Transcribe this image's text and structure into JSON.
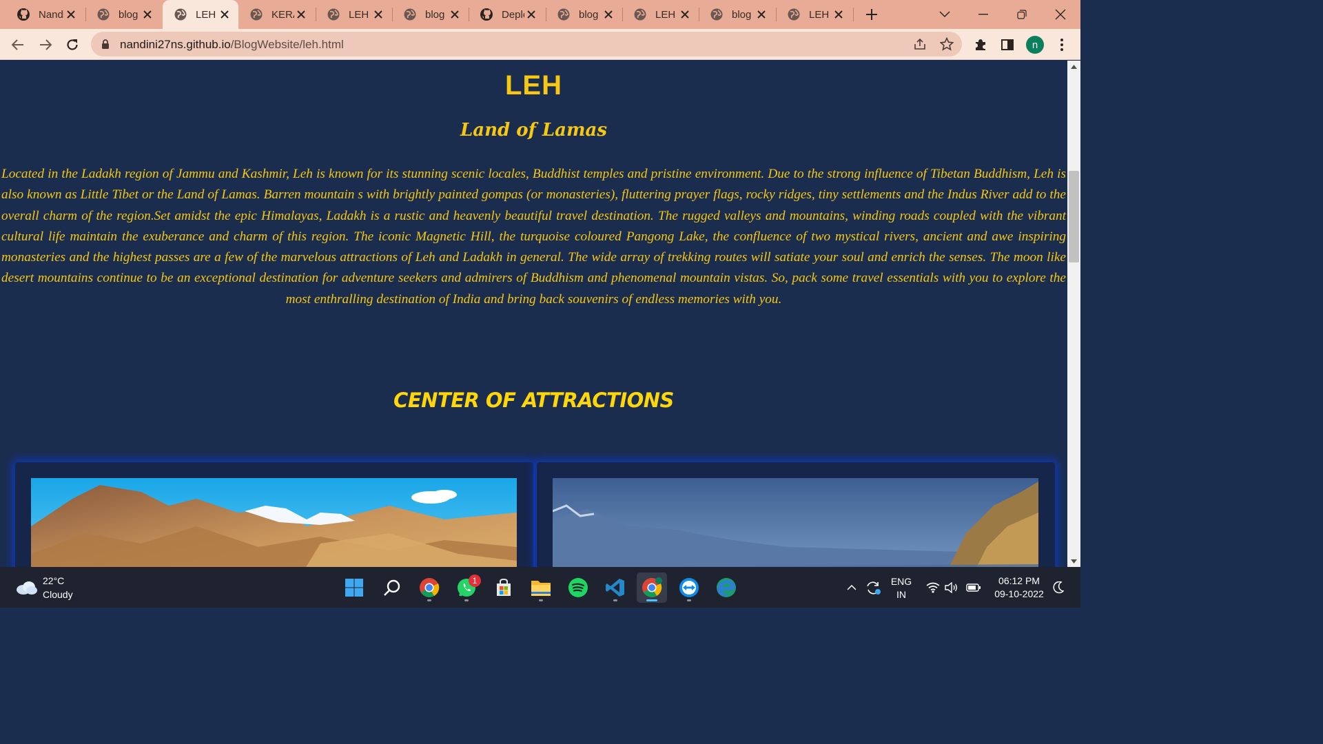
{
  "browser": {
    "tabs": [
      {
        "label": "Nandini",
        "favicon": "github-icon"
      },
      {
        "label": "blog",
        "favicon": "globe-icon"
      },
      {
        "label": "LEH",
        "favicon": "globe-icon",
        "active": true
      },
      {
        "label": "KERALA",
        "favicon": "globe-icon"
      },
      {
        "label": "LEH",
        "favicon": "globe-icon"
      },
      {
        "label": "blog",
        "favicon": "globe-icon"
      },
      {
        "label": "Deployments",
        "favicon": "github-icon"
      },
      {
        "label": "blog",
        "favicon": "globe-icon"
      },
      {
        "label": "LEH",
        "favicon": "globe-icon"
      },
      {
        "label": "blog",
        "favicon": "globe-icon"
      },
      {
        "label": "LEH",
        "favicon": "globe-icon"
      }
    ],
    "url_host": "nandini27ns.github.io",
    "url_path": "/BlogWebsite/leh.html",
    "profile_initial": "n"
  },
  "page": {
    "title": "LEH",
    "subtitle": "Land of Lamas",
    "intro": "Located in the Ladakh region of Jammu and Kashmir, Leh is known for its stunning scenic locales, Buddhist temples and pristine environment. Due to the strong influence of Tibetan Buddhism, Leh is also known as Little Tibet or the Land of Lamas. Barren mountain s with brightly painted gompas (or monasteries), fluttering prayer flags, rocky ridges, tiny settlements and the Indus River add to the overall charm of the region.Set amidst the epic Himalayas, Ladakh is a rustic and heavenly beautiful travel destination. The rugged valleys and mountains, winding roads coupled with the vibrant cultural life maintain the exuberance and charm of this region. The iconic Magnetic Hill, the turquoise coloured Pangong Lake, the confluence of two mystical rivers, ancient and awe inspiring monasteries and the highest passes are a few of the marvelous attractions of Leh and Ladakh in general. The wide array of trekking routes will satiate your soul and enrich the senses. The moon like desert mountains continue to be an exceptional destination for adventure seekers and admirers of Buddhism and phenomenal mountain vistas. So, pack some travel essentials with you to explore the most enthralling destination of India and bring back souvenirs of endless memories with you.",
    "section_heading": "CENTER OF ATTRACTIONS"
  },
  "taskbar": {
    "temperature": "22°C",
    "condition": "Cloudy",
    "whatsapp_badge": "1",
    "language": "ENG",
    "region": "IN",
    "time": "06:12 PM",
    "date": "09-10-2022"
  },
  "colors": {
    "page_bg": "#1b2d4f",
    "accent_yellow": "#f6c713",
    "card_glow": "#1038b8",
    "tabstrip_bg": "#e8ac96"
  }
}
